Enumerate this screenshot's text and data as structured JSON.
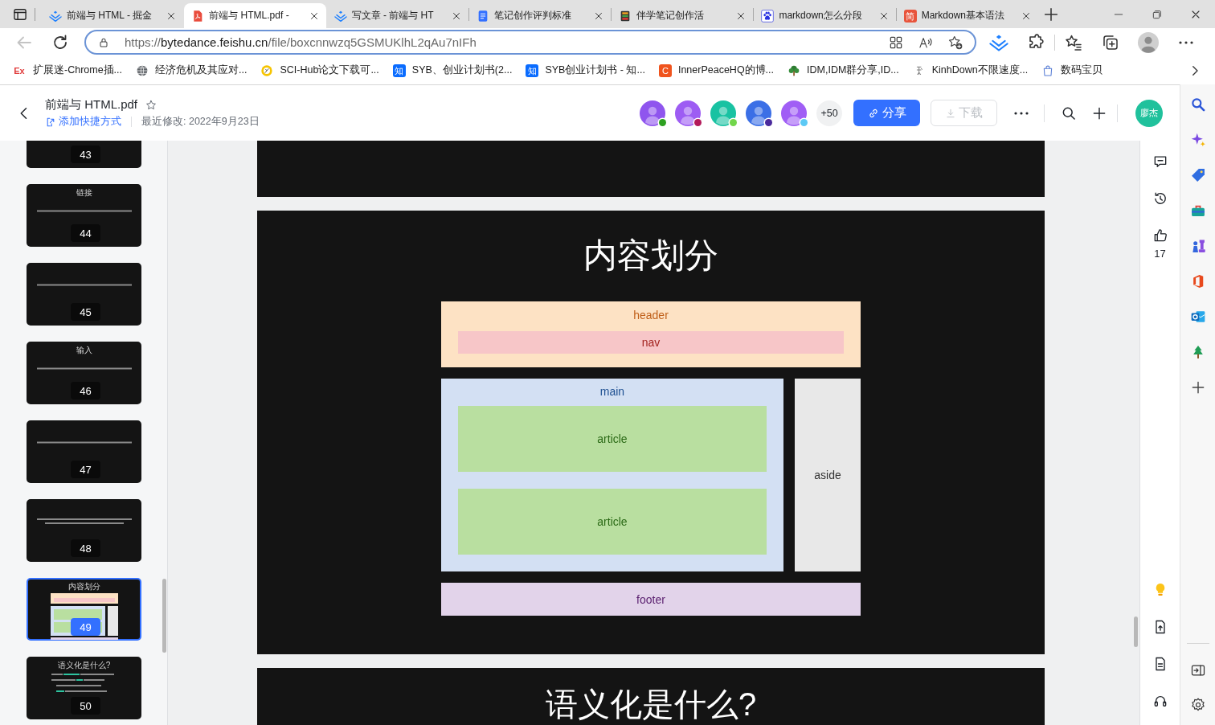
{
  "browser": {
    "tabs": [
      {
        "title": "前端与 HTML - 掘金",
        "selected": false
      },
      {
        "title": "前端与 HTML.pdf -",
        "selected": true
      },
      {
        "title": "写文章 - 前端与 HT",
        "selected": false
      },
      {
        "title": "笔记创作评判标准",
        "selected": false
      },
      {
        "title": "伴学笔记创作活",
        "selected": false
      },
      {
        "title": "markdown怎么分段",
        "selected": false
      },
      {
        "title": "Markdown基本语法",
        "selected": false,
        "icon_text": "简"
      }
    ],
    "address_bar": {
      "back_button": {
        "disabled": true
      },
      "url": "https://bytedance.feishu.cn/file/boxcnnwzq5GSMUKlhL2qAu7nIFh"
    },
    "bookmarks": [
      {
        "label": "扩展迷-Chrome插...",
        "icon_text": "Ex"
      },
      {
        "label": "经济危机及其应对..."
      },
      {
        "label": "SCI-Hub论文下载可..."
      },
      {
        "label": "SYB、创业计划书(2...",
        "icon_text": "知"
      },
      {
        "label": "SYB创业计划书 - 知...",
        "icon_text": "知"
      },
      {
        "label": "InnerPeaceHQ的博...",
        "icon_text": "C"
      },
      {
        "label": "IDM,IDM群分享,ID..."
      },
      {
        "label": "KinhDown不限速度..."
      },
      {
        "label": "数码宝贝"
      }
    ]
  },
  "header": {
    "title": "前端与 HTML.pdf",
    "shortcut_link": "添加快捷方式",
    "modified": "最近修改: 2022年9月23日",
    "collaborators": [
      {
        "color": "#2ea121"
      },
      {
        "color": "#b3195a"
      },
      {
        "color": "#72d64b"
      },
      {
        "color": "#4a2a9c"
      },
      {
        "color": "#5cc9f5"
      }
    ],
    "more_count": "+50",
    "share_button": "分享",
    "download_button": {
      "label": "下载",
      "disabled": true
    },
    "user_avatar": "廖杰"
  },
  "thumbnails": [
    {
      "number": "43",
      "kind": "none",
      "selected": false
    },
    {
      "number": "44",
      "kind": "line",
      "title": "链接",
      "selected": false
    },
    {
      "number": "45",
      "kind": "line",
      "selected": false
    },
    {
      "number": "46",
      "kind": "line",
      "title": "输入",
      "selected": false
    },
    {
      "number": "47",
      "kind": "line",
      "selected": false
    },
    {
      "number": "48",
      "kind": "lines",
      "selected": false
    },
    {
      "number": "49",
      "kind": "diagram",
      "title": "内容划分",
      "selected": true
    },
    {
      "number": "50",
      "kind": "bullets",
      "title": "语义化是什么?",
      "selected": false
    }
  ],
  "document": {
    "slides": [
      {
        "kind": "blank"
      },
      {
        "kind": "layout",
        "title": "内容划分",
        "diagram": {
          "header": "header",
          "nav": "nav",
          "main": "main",
          "articles": [
            "article",
            "article"
          ],
          "aside": "aside",
          "footer": "footer"
        }
      },
      {
        "kind": "title",
        "title": "语义化是什么?"
      }
    ]
  },
  "side_rail": {
    "like_count": "17"
  }
}
